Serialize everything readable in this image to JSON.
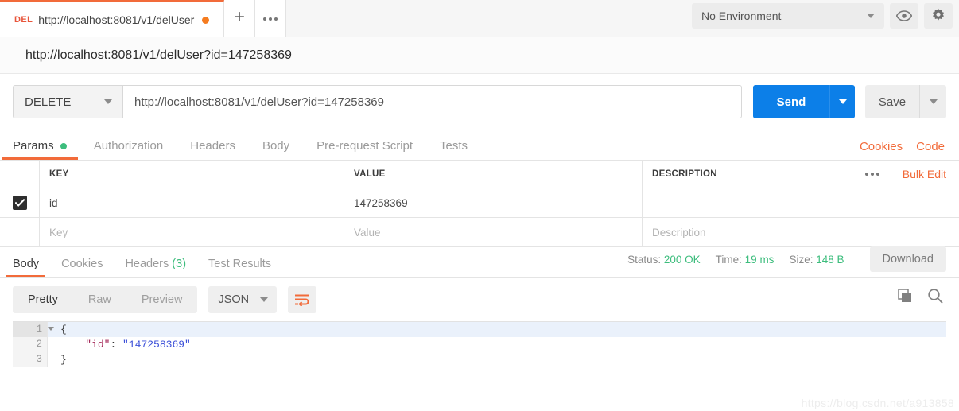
{
  "topbar": {
    "tab": {
      "method": "DEL",
      "url": "http://localhost:8081/v1/delUser",
      "unsaved_dot": "unsaved-indicator"
    },
    "new_tab_label": "+",
    "tab_menu_icon": "ellipsis-icon",
    "environment": {
      "selected": "No Environment",
      "eye_icon": "eye-icon",
      "settings_icon": "gear-icon"
    }
  },
  "request": {
    "title": "http://localhost:8081/v1/delUser?id=147258369",
    "method": "DELETE",
    "url_value": "http://localhost:8081/v1/delUser?id=147258369",
    "send_label": "Send",
    "save_label": "Save",
    "tabs": [
      {
        "label": "Params",
        "active": true,
        "dot": true
      },
      {
        "label": "Authorization",
        "active": false,
        "dot": false
      },
      {
        "label": "Headers",
        "active": false,
        "dot": false
      },
      {
        "label": "Body",
        "active": false,
        "dot": false
      },
      {
        "label": "Pre-request Script",
        "active": false,
        "dot": false
      },
      {
        "label": "Tests",
        "active": false,
        "dot": false
      }
    ],
    "cookies_link": "Cookies",
    "code_link": "Code"
  },
  "params": {
    "columns": {
      "key": "KEY",
      "value": "VALUE",
      "description": "DESCRIPTION"
    },
    "options_icon": "ellipsis-icon",
    "bulk_edit_label": "Bulk Edit",
    "rows": [
      {
        "checked": true,
        "key": "id",
        "value": "147258369",
        "description": ""
      }
    ],
    "placeholders": {
      "key": "Key",
      "value": "Value",
      "description": "Description"
    }
  },
  "response": {
    "tabs": [
      {
        "label": "Body",
        "active": true,
        "count": ""
      },
      {
        "label": "Cookies",
        "active": false,
        "count": ""
      },
      {
        "label": "Headers",
        "active": false,
        "count": "(3)"
      },
      {
        "label": "Test Results",
        "active": false,
        "count": ""
      }
    ],
    "status_label": "Status:",
    "status_value": "200 OK",
    "time_label": "Time:",
    "time_value": "19 ms",
    "size_label": "Size:",
    "size_value": "148 B",
    "download_label": "Download",
    "view_modes": [
      {
        "label": "Pretty",
        "active": true
      },
      {
        "label": "Raw",
        "active": false
      },
      {
        "label": "Preview",
        "active": false
      }
    ],
    "format": "JSON",
    "wrap_icon": "word-wrap-icon",
    "copy_icon": "copy-icon",
    "search_icon": "search-icon",
    "body_lines": [
      {
        "num": "1",
        "fold": true,
        "text": "{"
      },
      {
        "num": "2",
        "fold": false,
        "text": "    \"id\": \"147258369\"",
        "key": "\"id\"",
        "sep": ": ",
        "val": "\"147258369\"",
        "indent": "    "
      },
      {
        "num": "3",
        "fold": false,
        "text": "}"
      }
    ]
  },
  "watermark": "https://blog.csdn.net/a913858",
  "colors": {
    "accent_orange": "#f26b3a",
    "send_blue": "#0c7fe8",
    "success_green": "#3dbd7d",
    "method_red": "#e8553b"
  }
}
